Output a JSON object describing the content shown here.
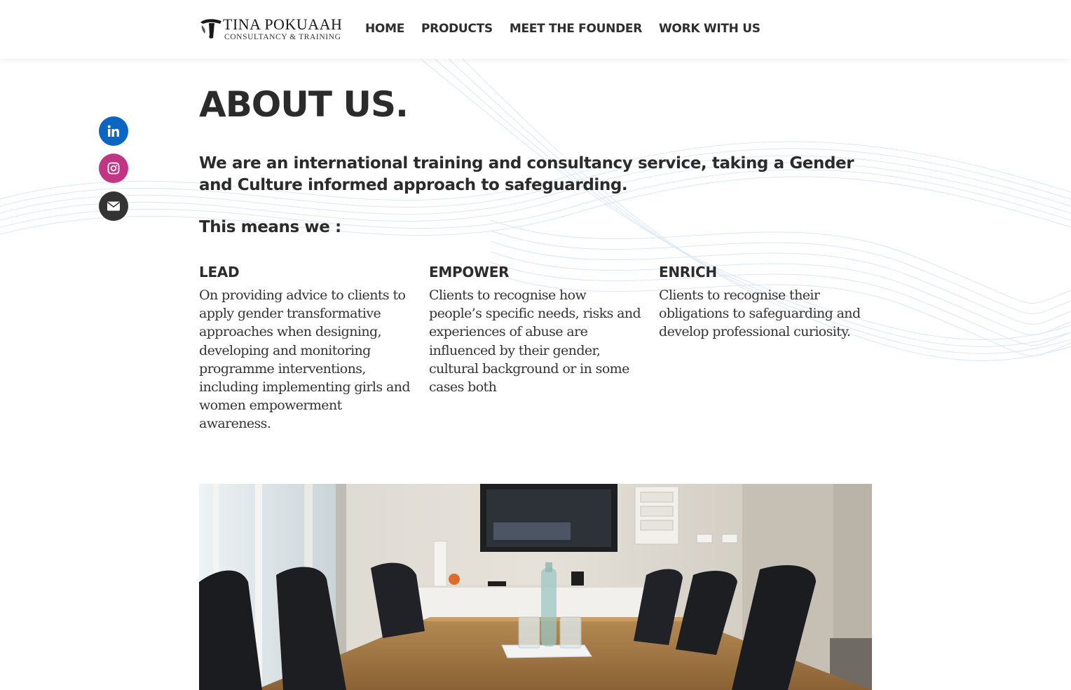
{
  "header": {
    "logo_title": "TINA POKUAAH",
    "logo_subtitle": "CONSULTANCY & TRAINING",
    "nav": [
      {
        "label": "HOME"
      },
      {
        "label": "PRODUCTS"
      },
      {
        "label": "MEET THE FOUNDER"
      },
      {
        "label": "WORK WITH US"
      }
    ]
  },
  "social": [
    {
      "icon": "linkedin-icon",
      "color": "#0a66c2"
    },
    {
      "icon": "instagram-icon",
      "color": "#c13584"
    },
    {
      "icon": "email-icon",
      "color": "#333333"
    }
  ],
  "about": {
    "title": "ABOUT US.",
    "intro": "We are an international training and consultancy service, taking a Gender and Culture informed approach to safeguarding.",
    "means_heading": "This means we :",
    "columns": [
      {
        "heading": "LEAD",
        "text": "On providing advice to clients to apply gender transformative approaches when designing, developing and monitoring programme interventions, including implementing girls and women empowerment awareness."
      },
      {
        "heading": "EMPOWER",
        "text": "Clients to recognise how people’s specific needs, risks and experiences of abuse are influenced by their gender, cultural background or in some cases both"
      },
      {
        "heading": "ENRICH",
        "text": "Clients to recognise their obligations to safeguarding and develop professional curiosity."
      }
    ]
  }
}
